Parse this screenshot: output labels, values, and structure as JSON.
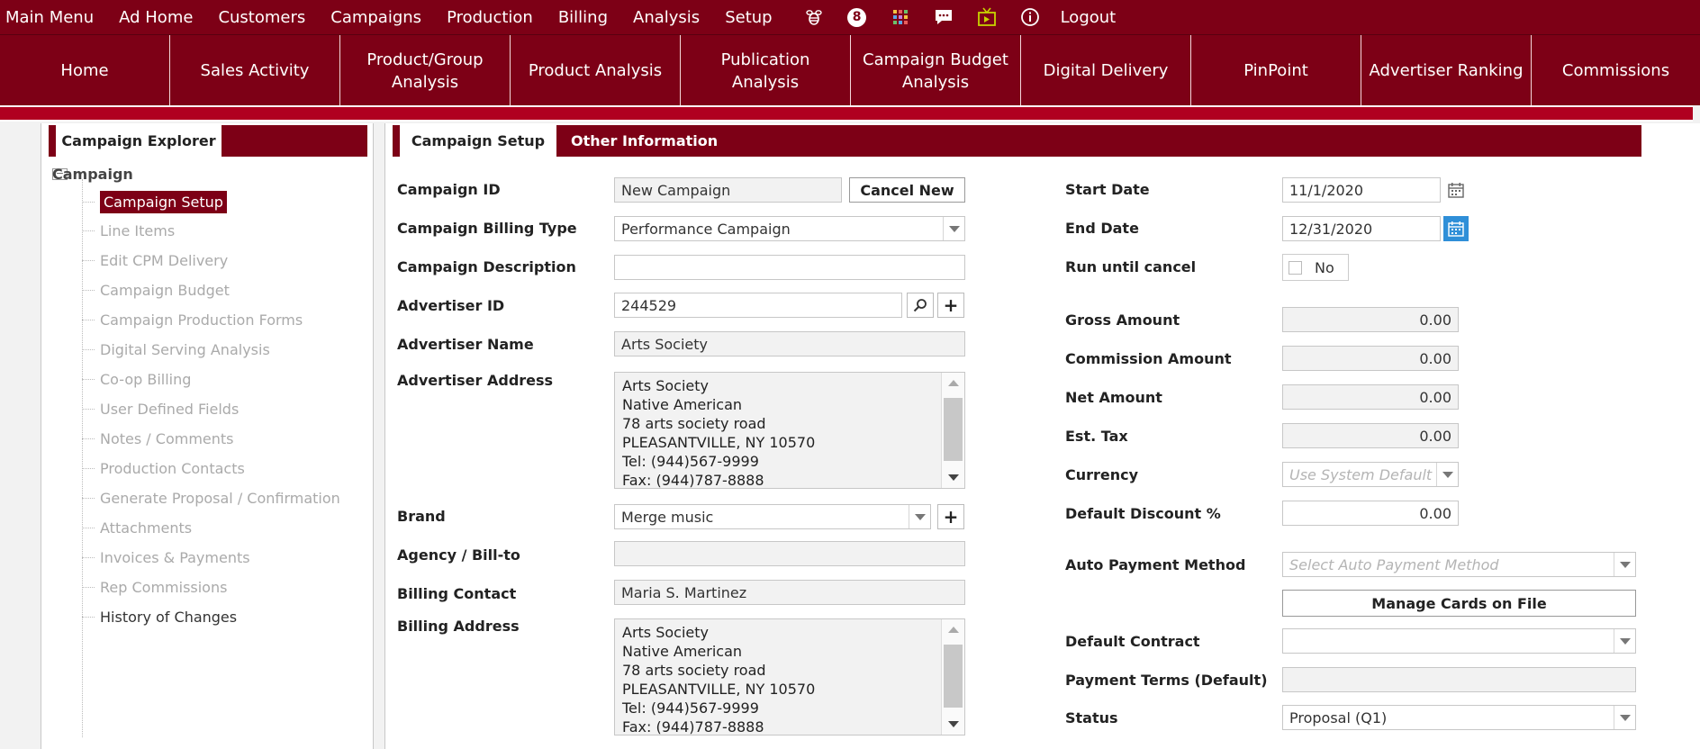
{
  "top_menu": {
    "items": [
      "Main Menu",
      "Ad Home",
      "Customers",
      "Campaigns",
      "Production",
      "Billing",
      "Analysis",
      "Setup"
    ],
    "badge_count": "8",
    "logout": "Logout"
  },
  "nav": {
    "items": [
      "Home",
      "Sales Activity",
      "Product/Group Analysis",
      "Product Analysis",
      "Publication Analysis",
      "Campaign Budget Analysis",
      "Digital Delivery",
      "PinPoint",
      "Advertiser Ranking",
      "Commissions"
    ]
  },
  "sidebar": {
    "tab": "Campaign Explorer",
    "root": "Campaign",
    "items": [
      "Campaign Setup",
      "Line Items",
      "Edit CPM Delivery",
      "Campaign Budget",
      "Campaign Production Forms",
      "Digital Serving Analysis",
      "Co-op Billing",
      "User Defined Fields",
      "Notes / Comments",
      "Production Contacts",
      "Generate Proposal / Confirmation",
      "Attachments",
      "Invoices & Payments",
      "Rep Commissions",
      "History of Changes"
    ]
  },
  "tabs": {
    "setup": "Campaign Setup",
    "other": "Other Information"
  },
  "form": {
    "campaign_id_label": "Campaign ID",
    "campaign_id": "New Campaign",
    "cancel_new": "Cancel New",
    "billing_type_label": "Campaign Billing Type",
    "billing_type": "Performance Campaign",
    "description_label": "Campaign Description",
    "description": "",
    "advertiser_id_label": "Advertiser ID",
    "advertiser_id": "244529",
    "advertiser_name_label": "Advertiser Name",
    "advertiser_name": "Arts Society",
    "advertiser_address_label": "Advertiser Address",
    "advertiser_address": [
      "Arts Society",
      "Native American",
      "78 arts society road",
      "PLEASANTVILLE, NY 10570",
      "Tel: (944)567-9999",
      "Fax: (944)787-8888"
    ],
    "brand_label": "Brand",
    "brand": "Merge music",
    "agency_label": "Agency / Bill-to",
    "agency": "",
    "billing_contact_label": "Billing Contact",
    "billing_contact": "Maria S. Martinez",
    "billing_address_label": "Billing Address",
    "billing_address": [
      "Arts Society",
      "Native American",
      "78 arts society road",
      "PLEASANTVILLE, NY 10570",
      "Tel: (944)567-9999",
      "Fax: (944)787-8888"
    ],
    "start_date_label": "Start Date",
    "start_date": "11/1/2020",
    "end_date_label": "End Date",
    "end_date": "12/31/2020",
    "run_until_cancel_label": "Run until cancel",
    "run_until_cancel": "No",
    "gross_label": "Gross Amount",
    "gross": "0.00",
    "commission_label": "Commission Amount",
    "commission": "0.00",
    "net_label": "Net Amount",
    "net": "0.00",
    "tax_label": "Est. Tax",
    "tax": "0.00",
    "currency_label": "Currency",
    "currency_placeholder": "Use System Default",
    "discount_label": "Default Discount %",
    "discount": "0.00",
    "auto_payment_label": "Auto Payment Method",
    "auto_payment_placeholder": "Select Auto Payment Method",
    "manage_cards": "Manage Cards on File",
    "default_contract_label": "Default Contract",
    "default_contract": "",
    "payment_terms_label": "Payment Terms (Default)",
    "payment_terms": "",
    "status_label": "Status",
    "status": "Proposal (Q1)"
  },
  "colors": {
    "brand": "#7d0016",
    "strip": "#b00020",
    "calendar_active": "#2f8fd8"
  }
}
